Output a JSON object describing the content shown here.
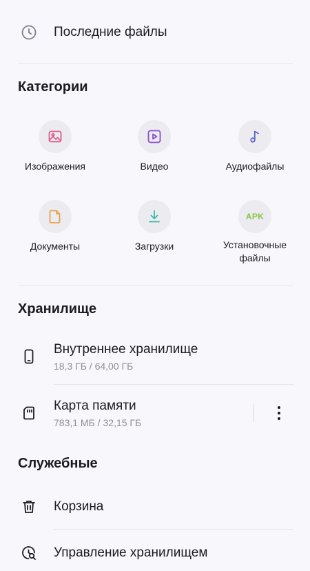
{
  "recent": {
    "label": "Последние файлы",
    "icon": "clock-icon"
  },
  "categories": {
    "title": "Категории",
    "items": [
      {
        "label": "Изображения",
        "icon": "image-icon",
        "color": "#e05a8a"
      },
      {
        "label": "Видео",
        "icon": "video-icon",
        "color": "#8a4fd0"
      },
      {
        "label": "Аудиофайлы",
        "icon": "music-note-icon",
        "color": "#5a66c8"
      },
      {
        "label": "Документы",
        "icon": "document-icon",
        "color": "#e6a24a"
      },
      {
        "label": "Загрузки",
        "icon": "download-icon",
        "color": "#3cb7a8"
      },
      {
        "label": "Установочные\nфайлы",
        "icon": "apk-icon",
        "badge": "APK",
        "color": "#8bc34a"
      }
    ]
  },
  "storage": {
    "title": "Хранилище",
    "items": [
      {
        "label": "Внутреннее хранилище",
        "sub": "18,3 ГБ / 64,00 ГБ",
        "icon": "phone-icon"
      },
      {
        "label": "Карта памяти",
        "sub": "783,1 МБ / 32,15 ГБ",
        "icon": "sd-card-icon"
      }
    ]
  },
  "utilities": {
    "title": "Служебные",
    "items": [
      {
        "label": "Корзина",
        "icon": "trash-icon"
      },
      {
        "label": "Управление хранилищем",
        "icon": "storage-search-icon"
      }
    ]
  }
}
